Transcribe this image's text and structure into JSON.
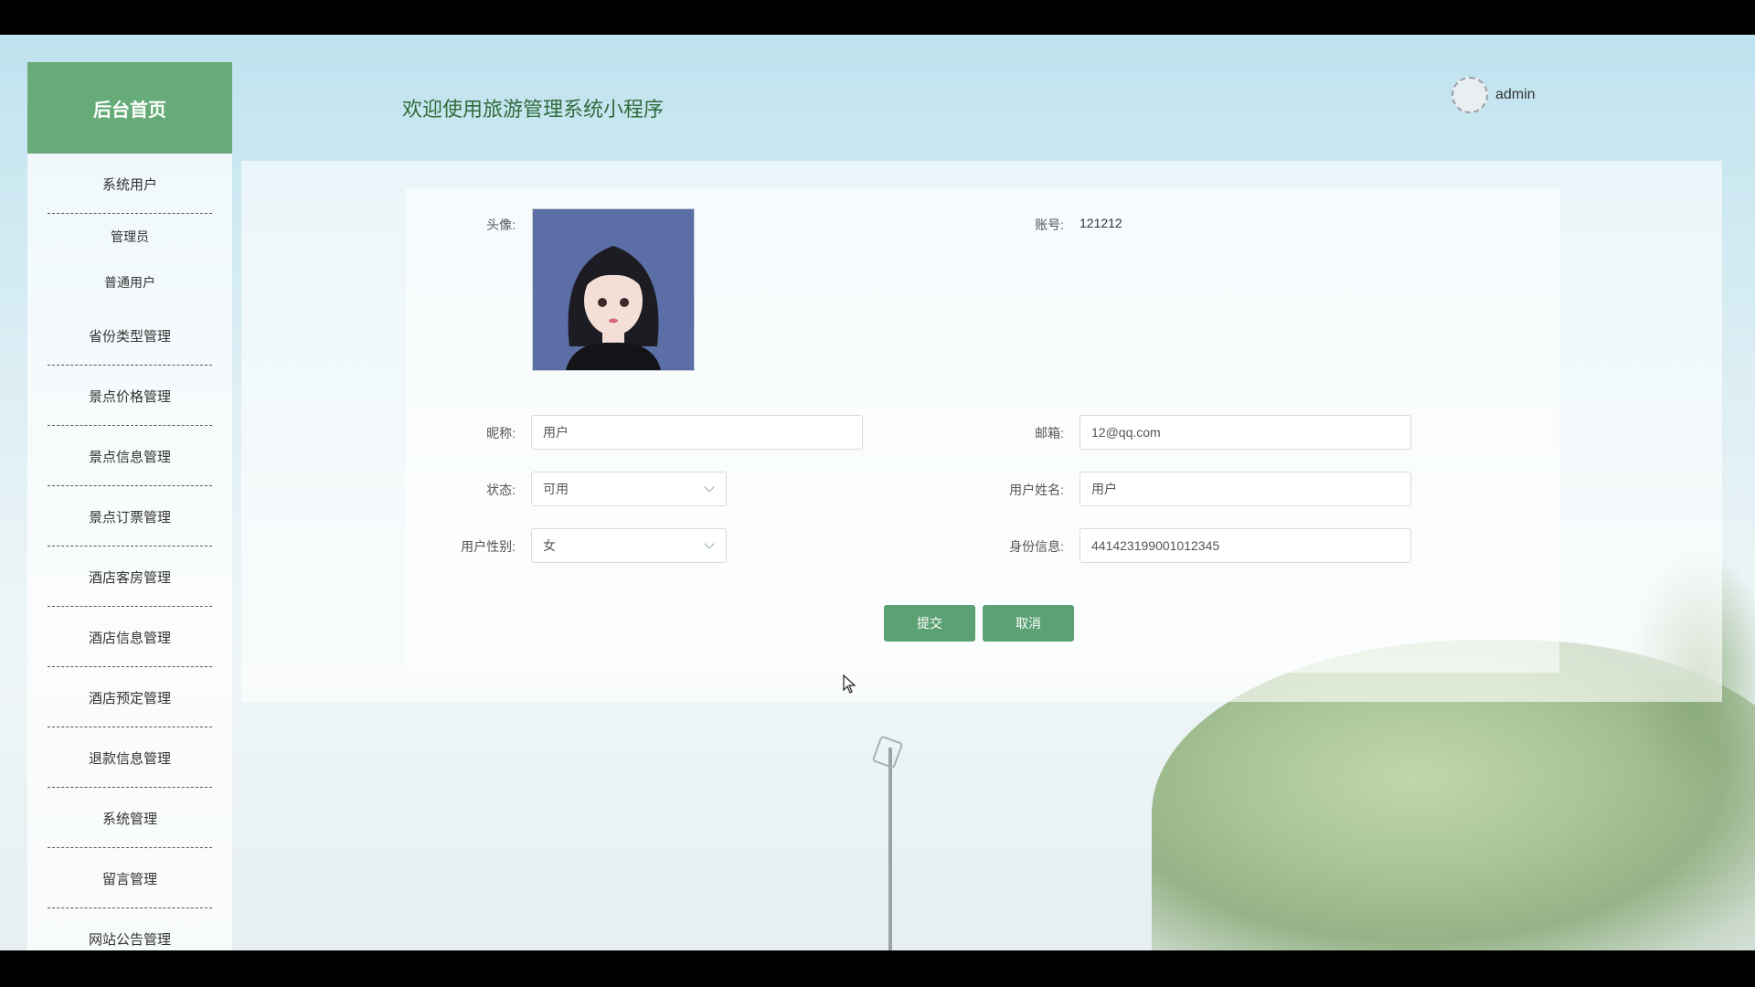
{
  "sidebar": {
    "header": "后台首页",
    "items": [
      {
        "label": "系统用户"
      },
      {
        "label": "管理员"
      },
      {
        "label": "普通用户"
      },
      {
        "label": "省份类型管理"
      },
      {
        "label": "景点价格管理"
      },
      {
        "label": "景点信息管理"
      },
      {
        "label": "景点订票管理"
      },
      {
        "label": "酒店客房管理"
      },
      {
        "label": "酒店信息管理"
      },
      {
        "label": "酒店预定管理"
      },
      {
        "label": "退款信息管理"
      },
      {
        "label": "系统管理"
      },
      {
        "label": "留言管理"
      },
      {
        "label": "网站公告管理"
      }
    ]
  },
  "header": {
    "title": "欢迎使用旅游管理系统小程序",
    "user": "admin"
  },
  "form": {
    "avatar_label": "头像:",
    "account_label": "账号:",
    "account_value": "121212",
    "nickname_label": "昵称:",
    "nickname_value": "用户",
    "email_label": "邮箱:",
    "email_value": "12@qq.com",
    "status_label": "状态:",
    "status_value": "可用",
    "username_label": "用户姓名:",
    "username_value": "用户",
    "gender_label": "用户性别:",
    "gender_value": "女",
    "id_label": "身份信息:",
    "id_value": "441423199001012345",
    "submit": "提交",
    "cancel": "取消"
  },
  "colors": {
    "accent": "#66ab78",
    "button": "#5ca174",
    "title": "#2f6b3a"
  }
}
